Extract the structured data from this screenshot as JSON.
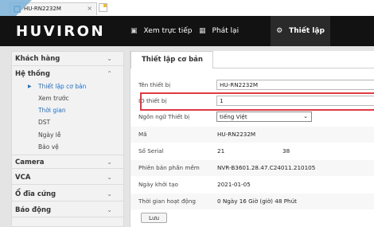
{
  "browser": {
    "tab_title": "HU-RN2232M",
    "tab_close": "×"
  },
  "header": {
    "logo": "HUVIRON",
    "nav": {
      "live": {
        "label": "Xem trực tiếp",
        "icon": "monitor-icon"
      },
      "playback": {
        "label": "Phát lại",
        "icon": "film-icon"
      },
      "setup": {
        "label": "Thiết lập",
        "icon": "gear-icon"
      }
    }
  },
  "sidebar": {
    "customer": "Khách hàng",
    "system": "Hệ thống",
    "system_items": [
      "Thiết lập cơ bản",
      "Xem trước",
      "Thời gian",
      "DST",
      "Ngày lễ",
      "Bảo vệ"
    ],
    "camera": "Camera",
    "vca": "VCA",
    "disk": "Ổ đĩa cứng",
    "alarm": "Báo động",
    "chevron_down": "⌄",
    "chevron_up": "⌃"
  },
  "main": {
    "tab": "Thiết lập cơ bản",
    "fields": {
      "device_name": {
        "label": "Tên thiết bị",
        "value": "HU-RN2232M"
      },
      "device_id": {
        "label": "ID thiết bị",
        "value": "1"
      },
      "language": {
        "label": "Ngôn ngữ Thiết bị",
        "value": "tiếng Việt"
      },
      "model": {
        "label": "Mã",
        "value": "HU-RN2232M"
      },
      "serial": {
        "label": "Số Serial",
        "value_a": "21",
        "value_b": "38"
      },
      "firmware": {
        "label": "Phiên bản phần mềm",
        "value": "NVR-B3601.28.47.C24011.210105"
      },
      "init_date": {
        "label": "Ngày khởi tạo",
        "value": "2021-01-05"
      },
      "uptime": {
        "label": "Thời gian hoạt động",
        "value": "0 Ngày  16 Giờ (giờ)  48 Phút"
      }
    },
    "save": "Lưu"
  },
  "colors": {
    "header_bg": "#121212",
    "active_link": "#1d6fc4",
    "highlight": "#e03a44"
  }
}
